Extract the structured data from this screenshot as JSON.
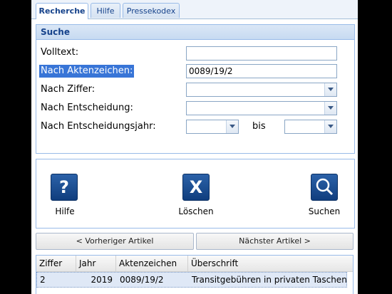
{
  "tabs": [
    {
      "label": "Recherche"
    },
    {
      "label": "Hilfe"
    },
    {
      "label": "Pressekodex"
    }
  ],
  "search": {
    "title": "Suche",
    "fields": {
      "volltext": {
        "label": "Volltext:",
        "value": ""
      },
      "aktenzeichen": {
        "label": "Nach Aktenzeichen:",
        "value": "0089/19/2"
      },
      "ziffer": {
        "label": "Nach Ziffer:",
        "value": ""
      },
      "entscheidung": {
        "label": "Nach Entscheidung:",
        "value": ""
      },
      "jahr": {
        "label": "Nach Entscheidungsjahr:",
        "from": "",
        "to_label": "bis",
        "to": ""
      }
    }
  },
  "actions": {
    "help": {
      "label": "Hilfe",
      "icon": "question-icon"
    },
    "clear": {
      "label": "Löschen",
      "icon": "x-icon"
    },
    "search": {
      "label": "Suchen",
      "icon": "magnifier-icon"
    }
  },
  "nav": {
    "prev": "< Vorheriger Artikel",
    "next": "Nächster Artikel >"
  },
  "results": {
    "columns": [
      "Ziffer",
      "Jahr",
      "Aktenzeichen",
      "Überschrift"
    ],
    "rows": [
      {
        "ziffer": "2",
        "jahr": "2019",
        "aktenzeichen": "0089/19/2",
        "ueberschrift": "Transitgebühren in privaten Taschen"
      }
    ]
  },
  "colors": {
    "accent": "#15428b",
    "panel_border": "#99bbe8",
    "selection": "#3875d7"
  }
}
